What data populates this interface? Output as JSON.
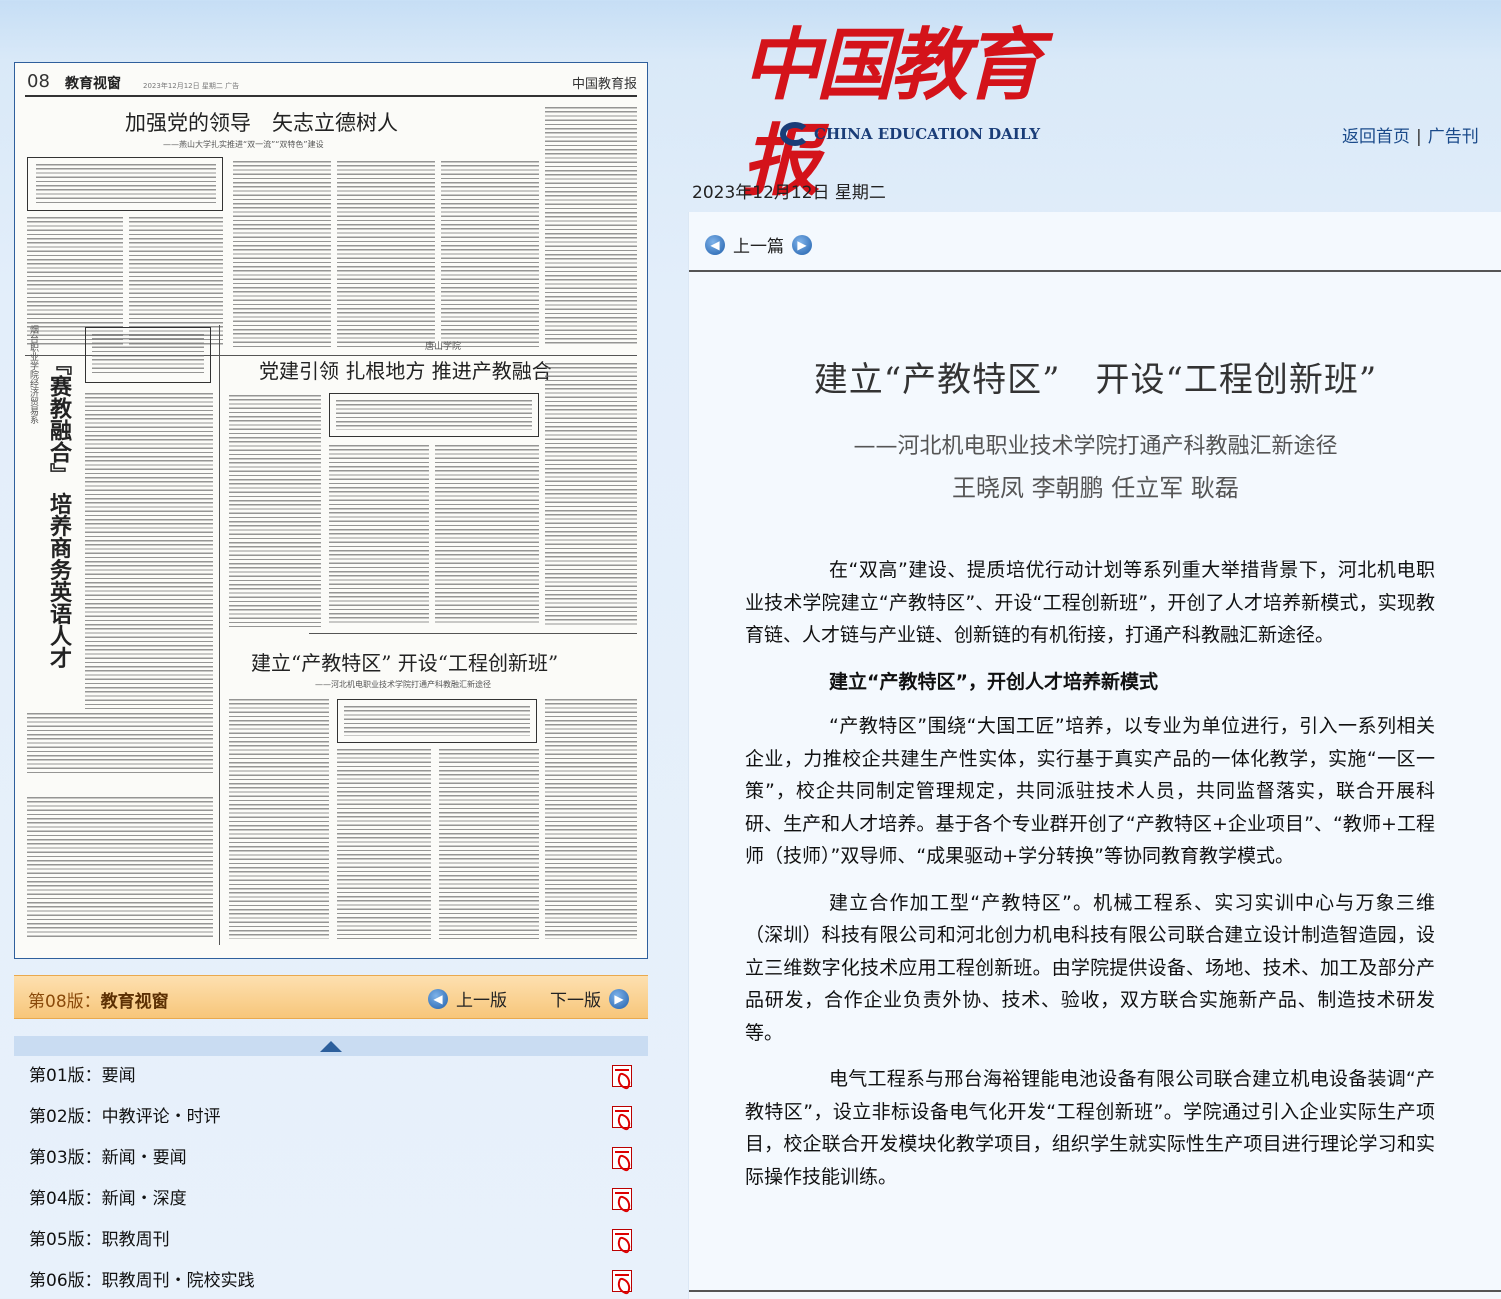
{
  "newspaper": {
    "logo_cn": "中国教育报",
    "logo_en": "CHINA EDUCATION DAILY"
  },
  "top_links": {
    "home": "返回首页",
    "separator": "|",
    "ads": "广告刊"
  },
  "date": "2023年12月12日 星期二",
  "page_image": {
    "page_number": "08",
    "section": "教育视窗",
    "small_info": "2023年12月12日 星期二 广告",
    "logo": "中国教育报",
    "headline1": "加强党的领导　矢志立德树人",
    "headline1_sub": "——燕山大学扎实推进“双一流”“双特色”建设",
    "kicker2": "唐山学院",
    "headline2": "党建引领 扎根地方 推进产教融合",
    "vertical_kicker": "烟台职业学院经济贸易系",
    "vertical_title": "『赛教融合』 培养商务英语人才",
    "headline3": "建立“产教特区” 开设“工程创新班”",
    "headline3_sub": "——河北机电职业技术学院打通产科教融汇新途径"
  },
  "edition_bar": {
    "label_prefix": "第08版：",
    "label_name": "教育视窗",
    "prev": "上一版",
    "next": "下一版"
  },
  "editions": [
    {
      "label": "第01版：要闻"
    },
    {
      "label": "第02版：中教评论・时评"
    },
    {
      "label": "第03版：新闻・要闻"
    },
    {
      "label": "第04版：新闻・深度"
    },
    {
      "label": "第05版：职教周刊"
    },
    {
      "label": "第06版：职教周刊・院校实践"
    }
  ],
  "article": {
    "prev": "上一篇",
    "title": "建立“产教特区”　开设“工程创新班”",
    "subtitle": "——河北机电职业技术学院打通产科教融汇新途径",
    "authors": "王晓凤 李朝鹏 任立军 耿磊",
    "paragraphs": [
      "在“双高”建设、提质培优行动计划等系列重大举措背景下，河北机电职业技术学院建立“产教特区”、开设“工程创新班”，开创了人才培养新模式，实现教育链、人才链与产业链、创新链的有机衔接，打通产科教融汇新途径。",
      "建立“产教特区”，开创人才培养新模式",
      "“产教特区”围绕“大国工匠”培养，以专业为单位进行，引入一系列相关企业，力推校企共建生产性实体，实行基于真实产品的一体化教学，实施“一区一策”，校企共同制定管理规定，共同派驻技术人员，共同监督落实，联合开展科研、生产和人才培养。基于各个专业群开创了“产教特区+企业项目”、“教师+工程师（技师）”双导师、“成果驱动+学分转换”等协同教育教学模式。",
      "建立合作加工型“产教特区”。机械工程系、实习实训中心与万象三维（深圳）科技有限公司和河北创力机电科技有限公司联合建立设计制造智造园，设立三维数字化技术应用工程创新班。由学院提供设备、场地、技术、加工及部分产品研发，合作企业负责外协、技术、验收，双方联合实施新产品、制造技术研发等。",
      "电气工程系与邢台海裕锂能电池设备有限公司联合建立机电设备装调“产教特区”，设立非标设备电气化开发“工程创新班”。学院通过引入企业实际生产项目，校企联合开发模块化教学项目，组织学生就实际性生产项目进行理论学习和实际操作技能训练。"
    ]
  },
  "colors": {
    "logo_red": "#d4131a",
    "link_blue": "#1a4a8a",
    "edition_bar_orange": "#f7c67a"
  },
  "icons": [
    "prev-arrow-icon",
    "next-arrow-icon",
    "pdf-icon",
    "collapse-up-icon"
  ]
}
